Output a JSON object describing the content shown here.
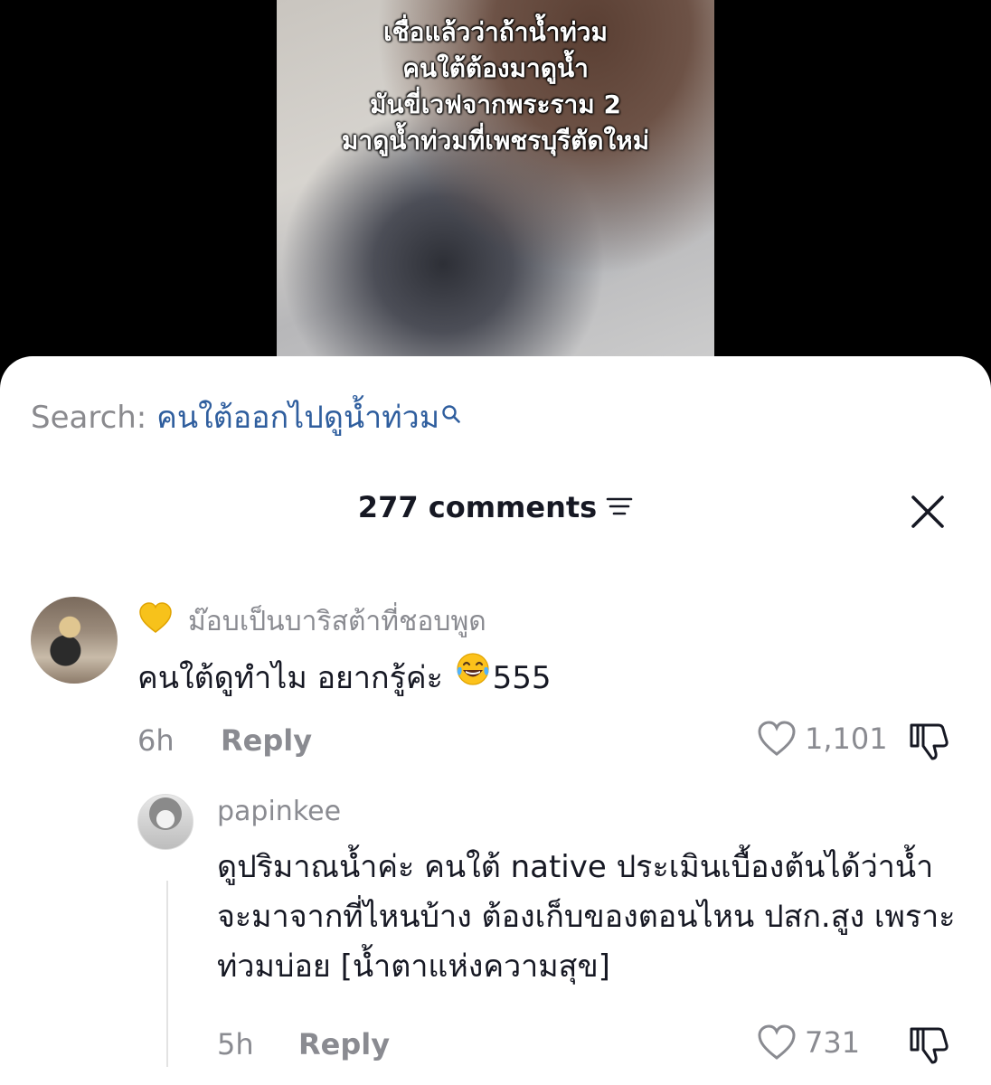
{
  "video": {
    "caption_lines": [
      "เชื่อแล้วว่าถ้าน้ำท่วม",
      "คนใต้ต้องมาดูน้ำ",
      "มันขี่เวฟจากพระราม 2",
      "มาดูน้ำท่วมที่เพชรบุรีตัดใหม่"
    ]
  },
  "search": {
    "label": "Search: ",
    "query": "คนใต้ออกไปดูน้ำท่วม",
    "icon": "search-icon"
  },
  "comments_header": {
    "title": "277 comments",
    "sort_icon": "sort-icon",
    "close_icon": "close-icon"
  },
  "comments": [
    {
      "badge_icon": "yellow-heart-icon",
      "username": "ม๊อบเป็นบาริสต้าที่ชอบพูด",
      "text_before_emoji": "คนใต้ดูทำไม อยากรู้ค่ะ ",
      "emoji": "laughing-tears-emoji",
      "text_after_emoji": "555",
      "time": "6h",
      "reply_label": "Reply",
      "likes": "1,101"
    },
    {
      "username": "papinkee",
      "text": "ดูปริมาณน้ำค่ะ คนใต้ native ประเมินเบื้องต้นได้ว่าน้ำจะมาจากที่ไหนบ้าง ต้องเก็บของตอนไหน ปสก.สูง เพราะท่วมบ่อย [น้ำตาแห่งความสุข]",
      "time": "5h",
      "reply_label": "Reply",
      "likes": "731"
    }
  ],
  "colors": {
    "text_primary": "#161823",
    "text_secondary": "#8a8b91",
    "link_blue": "#2f5e9e",
    "background": "#ffffff"
  }
}
